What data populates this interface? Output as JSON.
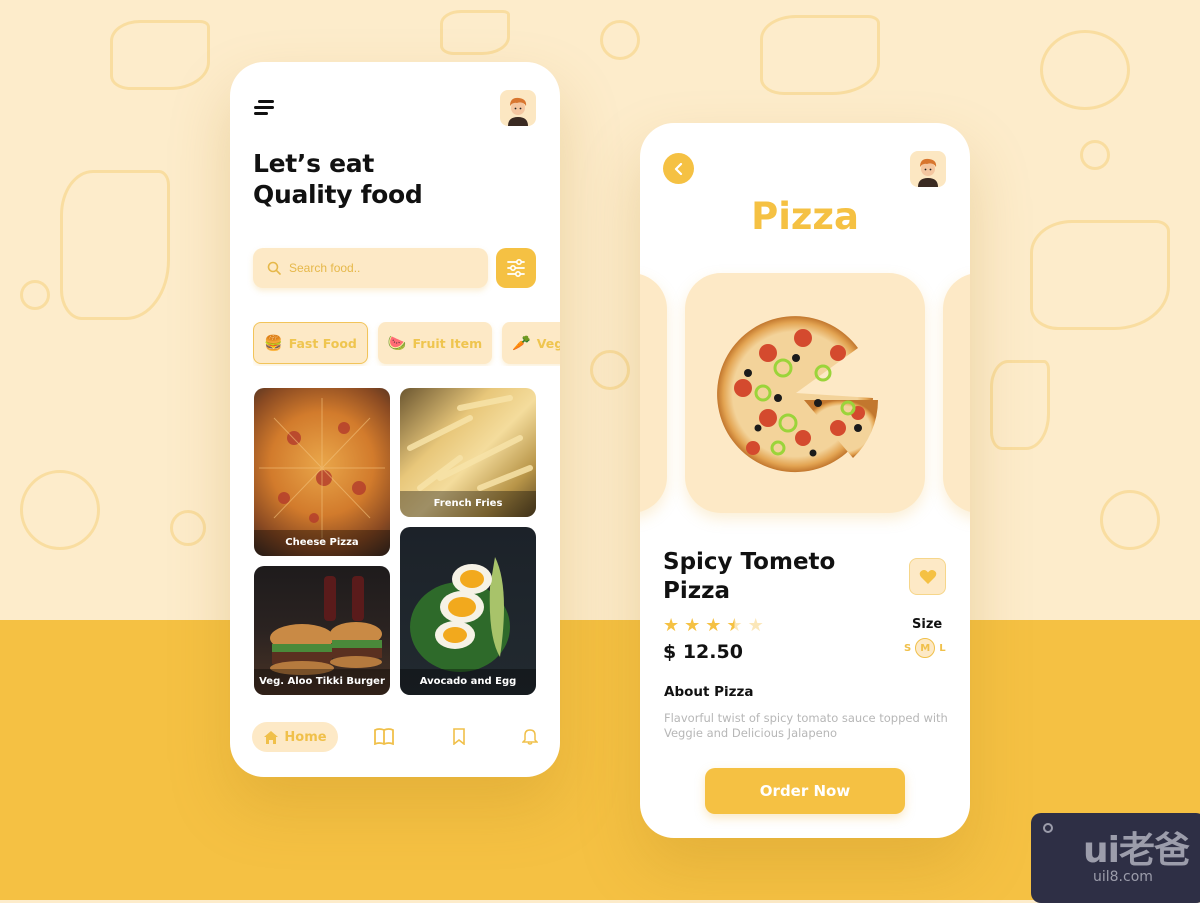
{
  "colors": {
    "accent": "#f5c143",
    "light_accent": "#fde9c6",
    "background_top": "#fdeccb",
    "background_bottom": "#f5c143"
  },
  "home_screen": {
    "menu_icon": "hamburger-menu-icon",
    "avatar": "user-avatar",
    "headline_line1": "Let’s eat",
    "headline_line2": "Quality food",
    "search": {
      "placeholder": "Search food..",
      "value": "",
      "icon": "search-icon"
    },
    "filter_icon": "sliders-icon",
    "categories": [
      {
        "label": "Fast Food",
        "icon": "🍔",
        "active": true
      },
      {
        "label": "Fruit Item",
        "icon": "🍉",
        "active": false
      },
      {
        "label": "Vegetables",
        "icon": "🥕",
        "active": false
      }
    ],
    "foods": [
      {
        "label": "Cheese Pizza"
      },
      {
        "label": "French Fries"
      },
      {
        "label": "Veg. Aloo Tikki Burger"
      },
      {
        "label": "Avocado and Egg"
      }
    ],
    "nav": {
      "home_label": "Home",
      "items": [
        "home-icon",
        "book-icon",
        "bookmark-icon",
        "bell-icon"
      ]
    }
  },
  "detail_screen": {
    "back_icon": "chevron-left-icon",
    "title": "Pizza",
    "product_name": "Spicy Tometo Pizza",
    "rating": 3.5,
    "rating_max": 5,
    "price": "$ 12.50",
    "size_label": "Size",
    "sizes": [
      "S",
      "M",
      "L"
    ],
    "selected_size": "M",
    "about_heading": "About Pizza",
    "about_text": "Flavorful twist of spicy tomato sauce topped with Veggie and Delicious Jalapeno",
    "order_button": "Order Now"
  },
  "watermark": {
    "logo": "ui老爸",
    "url": "uil8.com"
  }
}
